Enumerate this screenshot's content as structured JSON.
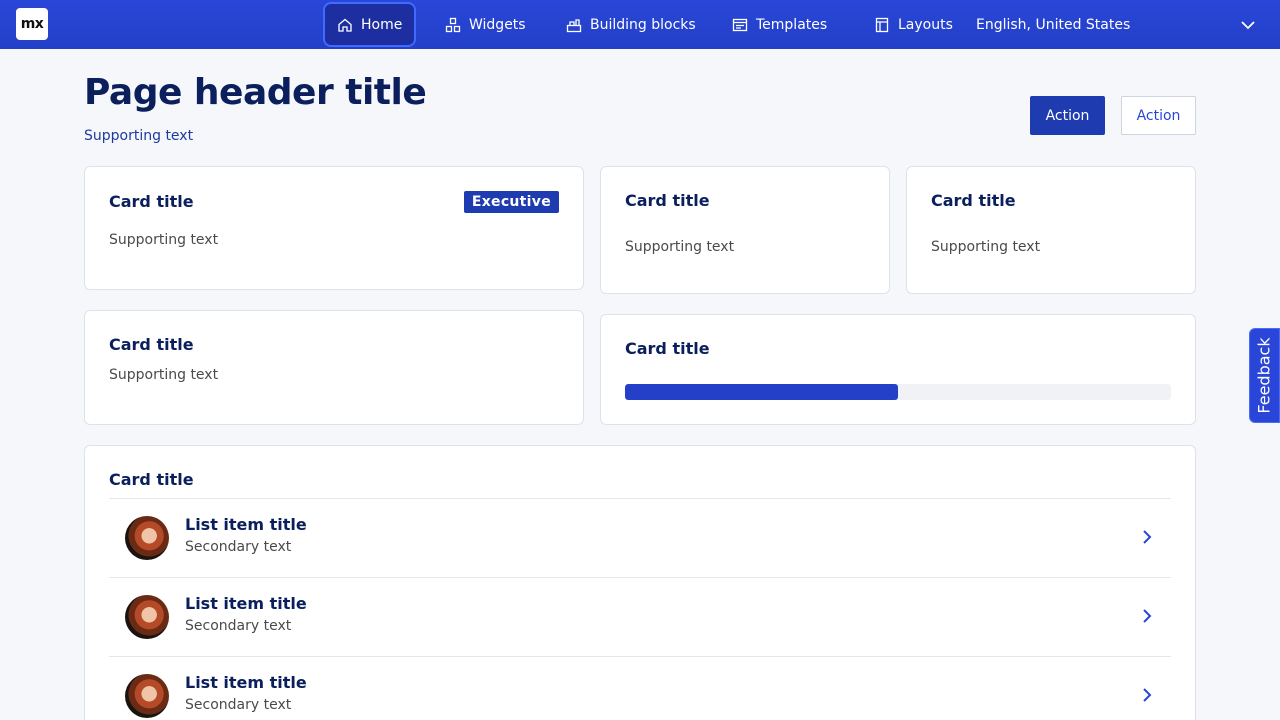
{
  "topbar": {
    "logo": "mx",
    "nav": [
      {
        "label": "Home",
        "icon": "home-icon",
        "active": true
      },
      {
        "label": "Widgets",
        "icon": "widgets-icon",
        "active": false
      },
      {
        "label": "Building blocks",
        "icon": "building-blocks-icon",
        "active": false
      },
      {
        "label": "Templates",
        "icon": "templates-icon",
        "active": false
      },
      {
        "label": "Layouts",
        "icon": "layouts-icon",
        "active": false
      }
    ],
    "language": "English, United States"
  },
  "header": {
    "title": "Page header title",
    "supporting_text": "Supporting text",
    "primary_action": "Action",
    "secondary_action": "Action"
  },
  "cards": {
    "card1": {
      "title": "Card title",
      "badge": "Executive",
      "supporting_text": "Supporting text"
    },
    "card2": {
      "title": "Card title",
      "supporting_text": "Supporting text"
    },
    "card3": {
      "title": "Card title",
      "supporting_text": "Supporting text"
    },
    "card4": {
      "title": "Card title",
      "supporting_text": "Supporting text"
    },
    "card5": {
      "title": "Card title",
      "progress": 0.5
    },
    "list_card": {
      "title": "Card title",
      "items": [
        {
          "title": "List item title",
          "secondary": "Secondary text"
        },
        {
          "title": "List item title",
          "secondary": "Secondary text"
        },
        {
          "title": "List item title",
          "secondary": "Secondary text"
        }
      ]
    }
  },
  "feedback": {
    "label": "Feedback"
  },
  "colors": {
    "brand": "#2946d8",
    "primary_button": "#1f3bb0",
    "heading": "#0a1f5c",
    "background": "#f5f7fa"
  }
}
